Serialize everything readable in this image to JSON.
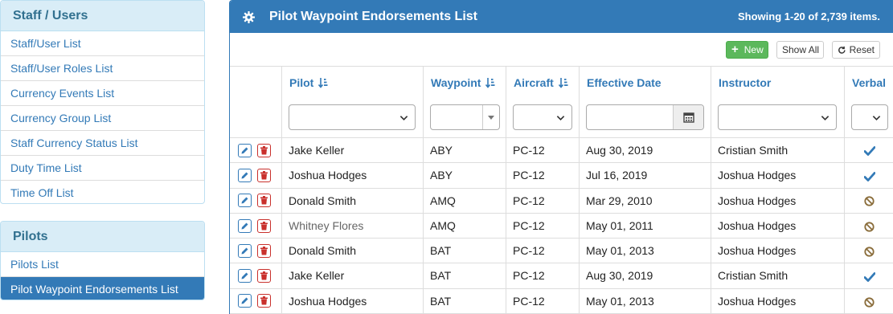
{
  "sidebar": {
    "staff": {
      "title": "Staff / Users",
      "items": [
        {
          "label": "Staff/User List"
        },
        {
          "label": "Staff/User Roles List"
        },
        {
          "label": "Currency Events List"
        },
        {
          "label": "Currency Group List"
        },
        {
          "label": "Staff Currency Status List"
        },
        {
          "label": "Duty Time List"
        },
        {
          "label": "Time Off List"
        }
      ]
    },
    "pilots": {
      "title": "Pilots",
      "items": [
        {
          "label": "Pilots List"
        },
        {
          "label": "Pilot Waypoint Endorsements List",
          "active": true
        }
      ]
    }
  },
  "panel": {
    "title": "Pilot Waypoint Endorsements List",
    "summary": "Showing 1-20 of 2,739 items.",
    "icon": "gear-icon"
  },
  "toolbar": {
    "new_label": "New",
    "show_all_label": "Show All",
    "reset_label": "Reset"
  },
  "columns": {
    "pilot": "Pilot",
    "waypoint": "Waypoint",
    "aircraft": "Aircraft",
    "effective_date": "Effective Date",
    "instructor": "Instructor",
    "verbal": "Verbal"
  },
  "rows": [
    {
      "pilot": "Jake Keller",
      "waypoint": "ABY",
      "aircraft": "PC-12",
      "date": "Aug 30, 2019",
      "instructor": "Cristian Smith",
      "verbal": "check"
    },
    {
      "pilot": "Joshua Hodges",
      "waypoint": "ABY",
      "aircraft": "PC-12",
      "date": "Jul 16, 2019",
      "instructor": "Joshua Hodges",
      "verbal": "check"
    },
    {
      "pilot": "Donald Smith",
      "waypoint": "AMQ",
      "aircraft": "PC-12",
      "date": "Mar 29, 2010",
      "instructor": "Joshua Hodges",
      "verbal": "ban"
    },
    {
      "pilot": "Whitney Flores",
      "waypoint": "AMQ",
      "aircraft": "PC-12",
      "date": "May 01, 2011",
      "instructor": "Joshua Hodges",
      "verbal": "ban",
      "muted": true
    },
    {
      "pilot": "Donald Smith",
      "waypoint": "BAT",
      "aircraft": "PC-12",
      "date": "May 01, 2013",
      "instructor": "Joshua Hodges",
      "verbal": "ban"
    },
    {
      "pilot": "Jake Keller",
      "waypoint": "BAT",
      "aircraft": "PC-12",
      "date": "Aug 30, 2019",
      "instructor": "Cristian Smith",
      "verbal": "check"
    },
    {
      "pilot": "Joshua Hodges",
      "waypoint": "BAT",
      "aircraft": "PC-12",
      "date": "May 01, 2013",
      "instructor": "Joshua Hodges",
      "verbal": "ban"
    }
  ],
  "colors": {
    "primary": "#337ab7",
    "success": "#5cb85c",
    "danger": "#c9302c",
    "ban": "#8a6d3b",
    "sidebar_head_bg": "#d9edf7",
    "sidebar_head_text": "#31708f"
  }
}
